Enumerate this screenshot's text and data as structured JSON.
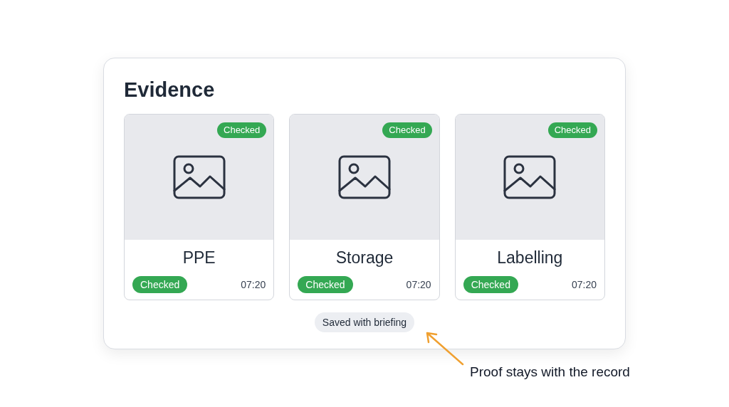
{
  "panel": {
    "title": "Evidence",
    "tiles": [
      {
        "top_badge": "Checked",
        "title": "PPE",
        "badge": "Checked",
        "time": "07:20"
      },
      {
        "top_badge": "Checked",
        "title": "Storage",
        "badge": "Checked",
        "time": "07:20"
      },
      {
        "top_badge": "Checked",
        "title": "Labelling",
        "badge": "Checked",
        "time": "07:20"
      }
    ],
    "footer_chip": "Saved with briefing"
  },
  "annotation": "Proof stays with the record"
}
